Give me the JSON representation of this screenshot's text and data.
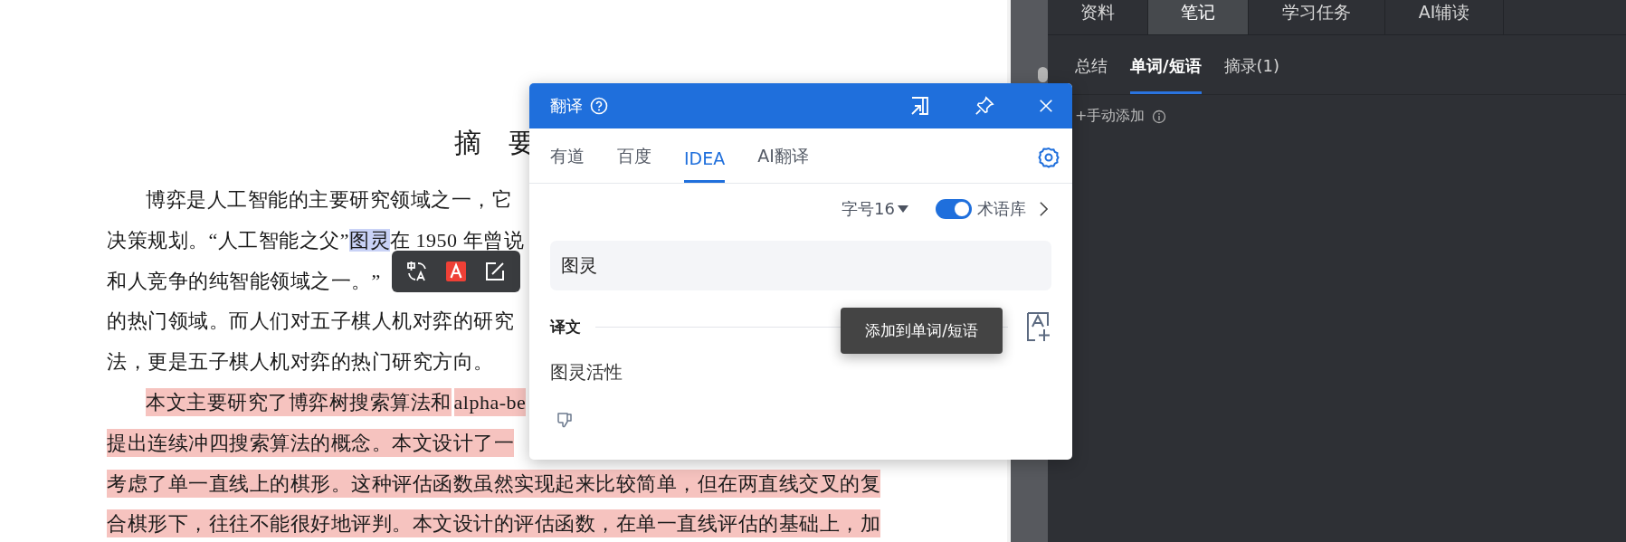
{
  "document": {
    "title": "摘　要",
    "lines": [
      {
        "indent": true,
        "segments": [
          {
            "kind": "plain",
            "text": "博弈是人工智能的主要研究领域之一，它"
          }
        ]
      },
      {
        "indent": false,
        "segments": [
          {
            "kind": "plain",
            "text": "决策规划。“人工智能之父”"
          },
          {
            "kind": "selection",
            "text": "图灵"
          },
          {
            "kind": "plain",
            "text": "在 1950 年曾说"
          }
        ]
      },
      {
        "indent": false,
        "segments": [
          {
            "kind": "plain",
            "text": "和人竞争的纯智能领域之一。”"
          }
        ]
      },
      {
        "indent": false,
        "segments": [
          {
            "kind": "plain",
            "text": "的热门领域。而人们对五子棋人机对弈的研究"
          }
        ]
      },
      {
        "indent": false,
        "segments": [
          {
            "kind": "plain",
            "text": "法，更是五子棋人机对弈的热门研究方向。"
          }
        ]
      },
      {
        "indent": true,
        "segments": [
          {
            "kind": "highlight",
            "text": "本文主要研究了博弈树搜索算法和"
          },
          {
            "kind": "highlight",
            "text": "alpha-be"
          }
        ]
      },
      {
        "indent": false,
        "segments": [
          {
            "kind": "highlight",
            "text": "提出连续冲四搜索算法的概念。本文设计了一"
          }
        ]
      },
      {
        "indent": false,
        "segments": [
          {
            "kind": "highlight",
            "text": "考虑了单一直线上的棋形。这种评估函数虽然实现起来比较简单，但在两直线交叉的复"
          }
        ]
      },
      {
        "indent": false,
        "segments": [
          {
            "kind": "highlight",
            "text": "合棋形下，往往不能很好地评判。本文设计的评估函数，在单一直线评估的基础上，加"
          }
        ]
      }
    ]
  },
  "popup": {
    "title": "翻译",
    "tabs": [
      {
        "label": "有道",
        "selected": false
      },
      {
        "label": "百度",
        "selected": false
      },
      {
        "label": "IDEA",
        "selected": true
      },
      {
        "label": "AI翻译",
        "selected": false
      }
    ],
    "font_size": "字号16",
    "glossary": {
      "label": "术语库",
      "on": true
    },
    "source": "图灵",
    "result_label": "译文",
    "result": "图灵活性",
    "tooltip": "添加到单词/短语"
  },
  "panel": {
    "tabs": [
      {
        "label": "资料",
        "selected": false
      },
      {
        "label": "笔记",
        "selected": true
      },
      {
        "label": "学习任务",
        "selected": false
      },
      {
        "label": "AI辅读",
        "selected": false
      }
    ],
    "subtabs": [
      {
        "label": "总结",
        "selected": false
      },
      {
        "label": "单词/短语",
        "selected": true
      },
      {
        "label": "摘录(1)",
        "selected": false
      }
    ],
    "add_link": "+手动添加"
  }
}
